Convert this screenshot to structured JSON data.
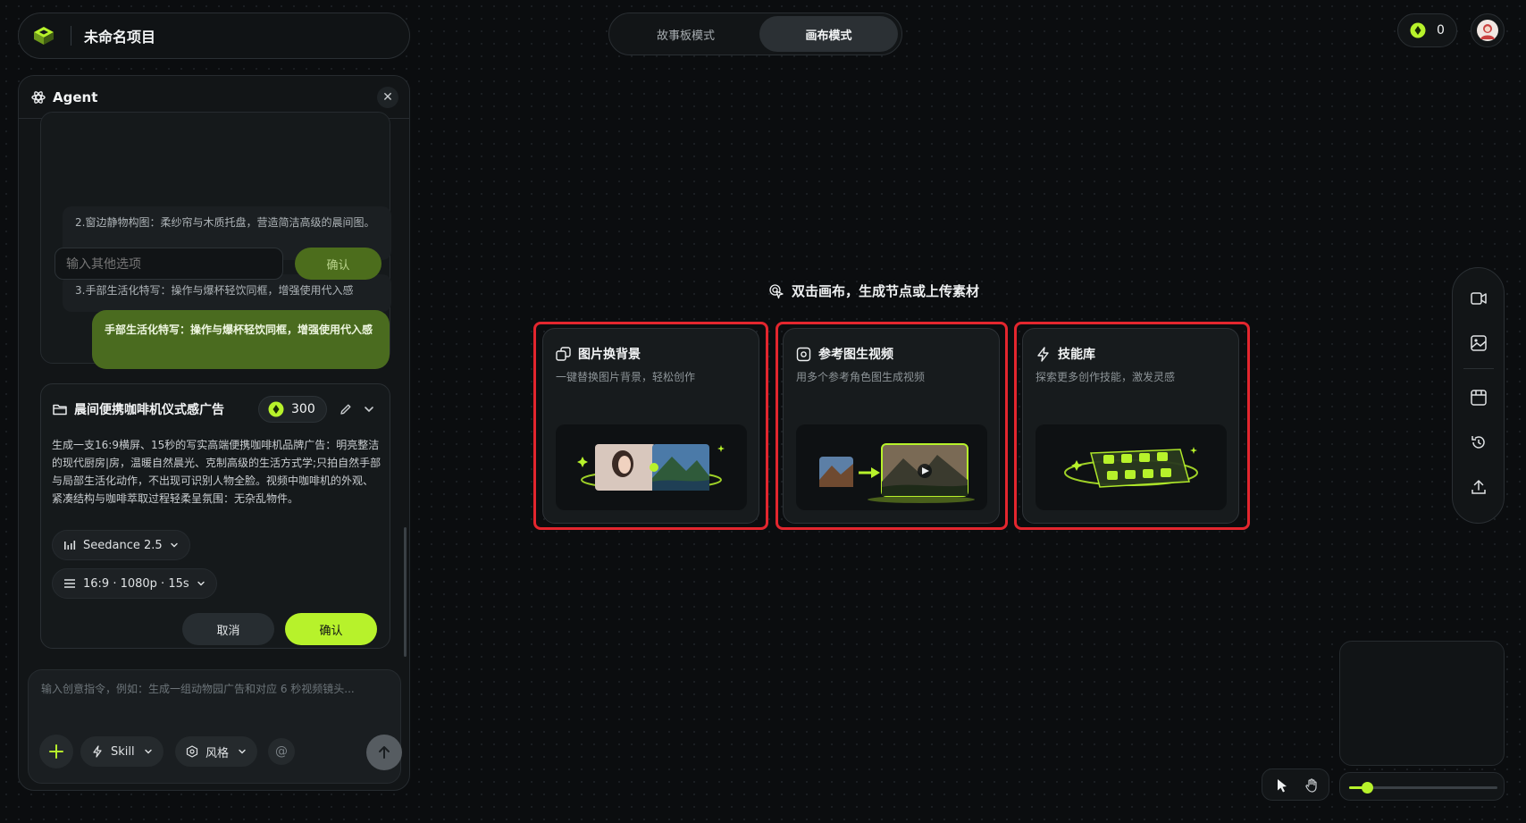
{
  "project": {
    "title": "未命名项目"
  },
  "mode_switch": {
    "tabs": [
      "故事板模式",
      "画布模式"
    ],
    "active": "画布模式"
  },
  "credits": {
    "balance": "0"
  },
  "agent": {
    "title": "Agent",
    "options": [
      "2.窗边静物构图：柔纱帘与木质托盘，营造简洁高级的晨间图。",
      "3.手部生活化特写：操作与爆杯轻饮同框，增强使用代入感"
    ],
    "other_input_placeholder": "输入其他选项",
    "option_confirm": "确认",
    "user_message": "手部生活化特写：操作与爆杯轻饮同框，增强使用代入感",
    "task": {
      "title": "晨间便携咖啡机仪式感广告",
      "cost": "300",
      "description": "生成一支16:9横屏、15秒的写实高端便携咖啡机品牌广告：明亮整洁的现代厨房|房，温暖自然晨光、克制高级的生活方式学;只拍自然手部与局部生活化动作，不出现可识别人物全脸。视频中咖啡机的外观、紧凑结构与咖啡萃取过程轻柔呈氛围：无杂乱物件。",
      "model": "Seedance 2.5",
      "spec": "16:9 · 1080p · 15s",
      "cancel": "取消",
      "confirm": "确认"
    },
    "composer": {
      "placeholder": "输入创意指令，例如：生成一组动物园广告和对应 6 秒视频镜头...",
      "skill_label": "Skill",
      "style_label": "风格",
      "mention": "@"
    }
  },
  "canvas": {
    "hint": "双击画布，生成节点或上传素材",
    "cards": [
      {
        "title": "图片换背景",
        "subtitle": "一键替换图片背景，轻松创作",
        "icon": "image-swap-icon"
      },
      {
        "title": "参考图生视频",
        "subtitle": "用多个参考角色图生成视频",
        "icon": "reference-video-icon"
      },
      {
        "title": "技能库",
        "subtitle": "探索更多创作技能，激发灵感",
        "icon": "lightning-icon"
      }
    ]
  },
  "right_toolbar": [
    "video-clip-icon",
    "image-icon",
    "storyboard-icon",
    "history-icon",
    "upload-icon"
  ],
  "zoom": {
    "level_fraction": 0.12
  },
  "colors": {
    "accent": "#b7f22b",
    "highlight_border": "#e3262e",
    "background": "#0b0d0f"
  }
}
